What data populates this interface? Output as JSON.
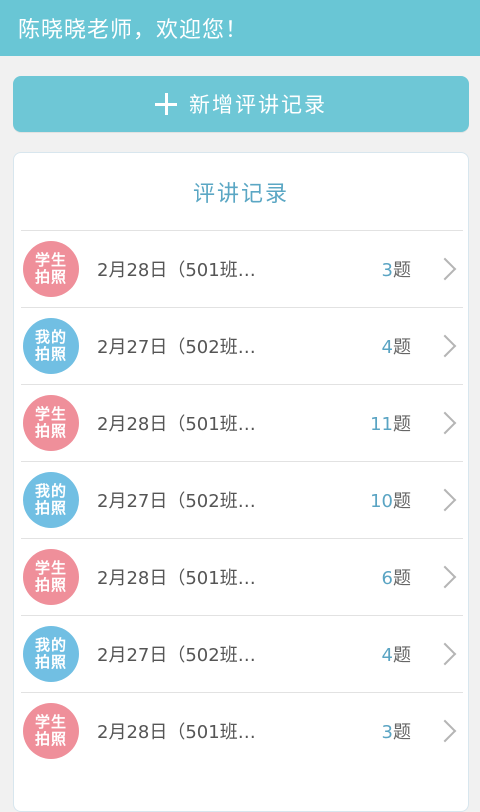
{
  "header": {
    "greeting": "陈晓晓老师，欢迎您！"
  },
  "add_button": {
    "label": "新增评讲记录"
  },
  "records": {
    "title": "评讲记录",
    "items": [
      {
        "badge": [
          "学生",
          "拍照"
        ],
        "badge_color": "#ef8f9a",
        "text": "2月28日（501班…",
        "count": "3",
        "unit": "题"
      },
      {
        "badge": [
          "我的",
          "拍照"
        ],
        "badge_color": "#71bfe3",
        "text": "2月27日（502班…",
        "count": "4",
        "unit": "题"
      },
      {
        "badge": [
          "学生",
          "拍照"
        ],
        "badge_color": "#ef8f9a",
        "text": "2月28日（501班…",
        "count": "11",
        "unit": "题"
      },
      {
        "badge": [
          "我的",
          "拍照"
        ],
        "badge_color": "#71bfe3",
        "text": "2月27日（502班…",
        "count": "10",
        "unit": "题"
      },
      {
        "badge": [
          "学生",
          "拍照"
        ],
        "badge_color": "#ef8f9a",
        "text": "2月28日（501班…",
        "count": "6",
        "unit": "题"
      },
      {
        "badge": [
          "我的",
          "拍照"
        ],
        "badge_color": "#71bfe3",
        "text": "2月27日（502班…",
        "count": "4",
        "unit": "题"
      },
      {
        "badge": [
          "学生",
          "拍照"
        ],
        "badge_color": "#ef8f9a",
        "text": "2月28日（501班…",
        "count": "3",
        "unit": "题"
      }
    ]
  },
  "colors": {
    "header": "#69c6d5",
    "accent": "#5aa4c3",
    "pink_badge": "#ef8f9a",
    "blue_badge": "#71bfe3"
  }
}
